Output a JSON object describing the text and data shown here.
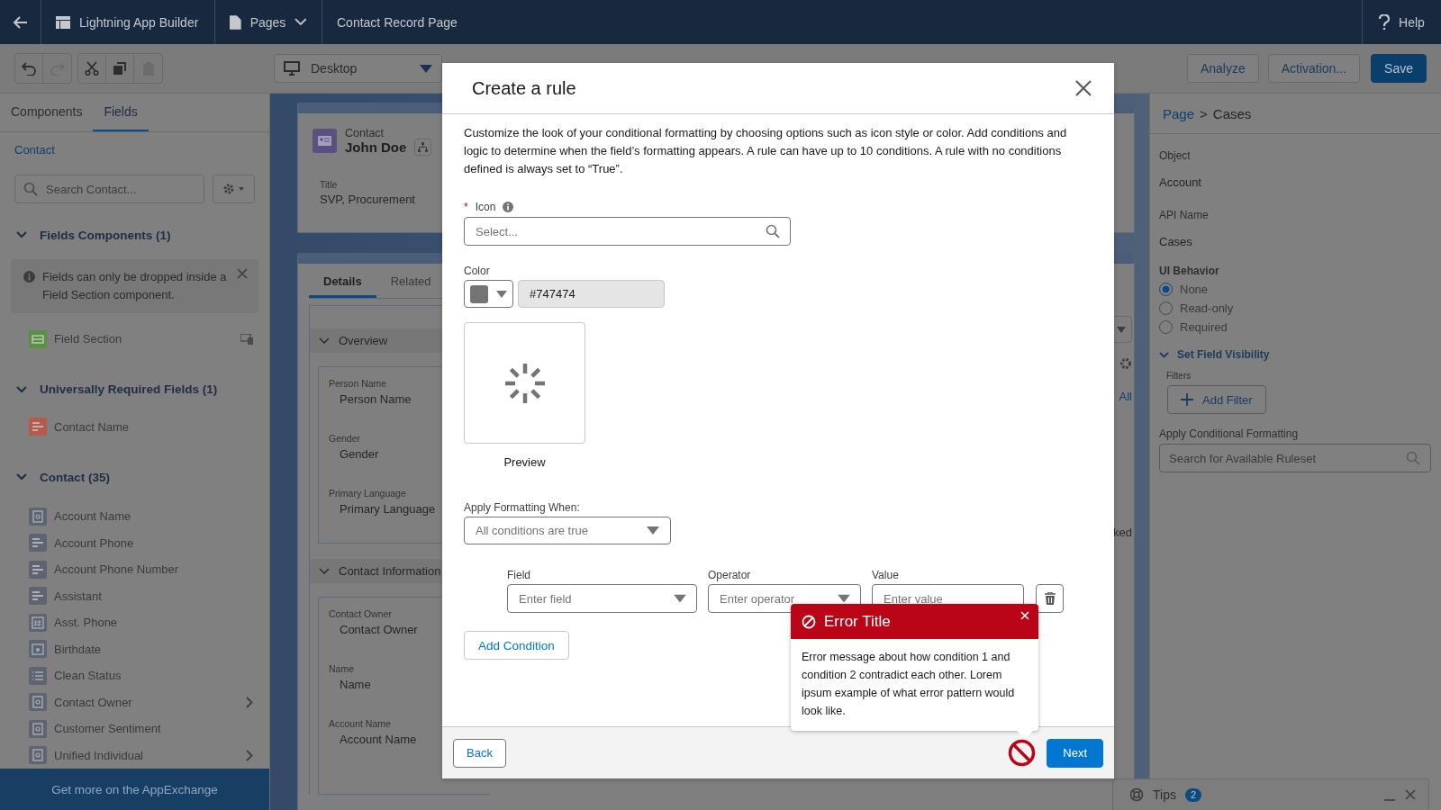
{
  "top_bar": {
    "app_name": "Lightning App Builder",
    "pages_menu": "Pages",
    "page_name": "Contact Record Page",
    "help": "Help"
  },
  "toolbar": {
    "tools": [
      {
        "kind": "undo",
        "disabled": false
      },
      {
        "kind": "redo",
        "disabled": true
      },
      {
        "kind": "cut",
        "disabled": false
      },
      {
        "kind": "copy",
        "disabled": false
      },
      {
        "kind": "paste",
        "disabled": true
      }
    ],
    "device": "Desktop",
    "buttons": [
      {
        "label": "Analyze",
        "kind": "outline"
      },
      {
        "label": "Activation...",
        "kind": "outline"
      },
      {
        "label": "Save",
        "kind": "brand"
      }
    ]
  },
  "left_panel": {
    "tabs": [
      {
        "label": "Components",
        "selected": false
      },
      {
        "label": "Fields",
        "selected": true
      }
    ],
    "object_link": "Contact",
    "search": {
      "placeholder": "Search Contact..."
    },
    "sections": [
      {
        "title": "Fields Components (1)",
        "expanded": true,
        "notice": "Fields can only be dropped inside a Field Section component.",
        "items": [
          {
            "label": "Field Section",
            "kind": "section",
            "color": "#5a8f45",
            "expandable": false,
            "device_icon": true
          }
        ]
      },
      {
        "title": "Universally Required Fields (1)",
        "expanded": true,
        "items": [
          {
            "label": "Contact Name",
            "kind": "text",
            "color": "#b65a4e",
            "expandable": false,
            "device_icon": false
          }
        ]
      },
      {
        "title": "Contact (35)",
        "expanded": true,
        "items": [
          {
            "label": "Account Name",
            "kind": "lookup",
            "color": "#5d6472",
            "expandable": false,
            "device_icon": false
          },
          {
            "label": "Account Phone",
            "kind": "text",
            "color": "#5d6472",
            "expandable": false,
            "device_icon": false
          },
          {
            "label": "Account Phone Number",
            "kind": "text",
            "color": "#5d6472",
            "expandable": false,
            "device_icon": false
          },
          {
            "label": "Assistant",
            "kind": "text",
            "color": "#5d6472",
            "expandable": false,
            "device_icon": false
          },
          {
            "label": "Asst. Phone",
            "kind": "number",
            "color": "#5d6472",
            "expandable": false,
            "device_icon": false
          },
          {
            "label": "Birthdate",
            "kind": "date",
            "color": "#5d6472",
            "expandable": false,
            "device_icon": false
          },
          {
            "label": "Clean Status",
            "kind": "picklist",
            "color": "#5d6472",
            "expandable": false,
            "device_icon": false
          },
          {
            "label": "Contact Owner",
            "kind": "lookup",
            "color": "#5d6472",
            "expandable": true,
            "device_icon": false
          },
          {
            "label": "Customer Sentiment",
            "kind": "lookup",
            "color": "#5d6472",
            "expandable": false,
            "device_icon": false
          },
          {
            "label": "Unified Individual",
            "kind": "lookup",
            "color": "#5d6472",
            "expandable": true,
            "device_icon": false
          }
        ]
      }
    ],
    "footer": "Get more on the AppExchange"
  },
  "canvas": {
    "header": {
      "object": "Contact",
      "name": "John Doe",
      "field_label": "Title",
      "field_value": "SVP, Procurement"
    },
    "tabs": [
      {
        "label": "Details",
        "selected": true
      },
      {
        "label": "Related",
        "selected": false
      }
    ],
    "sections": [
      {
        "title": "Overview",
        "fields": [
          {
            "label": "Person Name",
            "value": "Person Name"
          },
          {
            "label": "Gender",
            "value": "Gender"
          },
          {
            "label": "Primary Language",
            "value": "Primary Language"
          }
        ]
      },
      {
        "title": "Contact Information",
        "fields": [
          {
            "label": "Contact Owner",
            "value": "Contact Owner"
          },
          {
            "label": "Name",
            "value": "Name"
          },
          {
            "label": "Account Name",
            "value": "Account Name"
          }
        ]
      }
    ],
    "cut_link": "All",
    "cut_text": "ked"
  },
  "right_panel": {
    "breadcrumb": {
      "link": "Page",
      "separator": ">",
      "current": "Cases"
    },
    "properties": [
      {
        "label": "Object",
        "value": "Account"
      },
      {
        "label": "API Name",
        "value": "Cases"
      }
    ],
    "ui_behavior": {
      "label": "UI Behavior",
      "options": [
        {
          "label": "None",
          "selected": true
        },
        {
          "label": "Read-only",
          "selected": false
        },
        {
          "label": "Required",
          "selected": false
        }
      ]
    },
    "visibility": {
      "title": "Set Field Visibility",
      "expanded": true,
      "filters_label": "Filters",
      "add_filter": "Add Filter"
    },
    "formatting": {
      "label": "Apply Conditional Formatting",
      "placeholder": "Search for Available Ruleset"
    }
  },
  "tips": {
    "label": "Tips",
    "count": "2"
  },
  "modal": {
    "title": "Create a rule",
    "description": "Customize the look of your conditional formatting by choosing options such as icon style or color. Add conditions and logic to determine when the field’s formatting appears. A rule can have up to 10 conditions. A rule with no conditions defined is always set to “True”.",
    "icon_field": {
      "required_mark": "*",
      "label": "Icon",
      "required": true,
      "placeholder": "Select..."
    },
    "color_field": {
      "label": "Color",
      "value": "#747474"
    },
    "preview_label": "Preview",
    "apply_when": {
      "label": "Apply Formatting When:",
      "value": "All conditions are true"
    },
    "condition": {
      "field": {
        "label": "Field",
        "placeholder": "Enter field"
      },
      "operator": {
        "label": "Operator",
        "placeholder": "Enter operator"
      },
      "value": {
        "label": "Value",
        "placeholder": "Enter value"
      }
    },
    "add_condition": "Add Condition",
    "back": "Back",
    "next": "Next",
    "has_error": true,
    "error": {
      "title": "Error Title",
      "message": "Error message about how condition 1 and condition 2 contradict each other. Lorem ipsum example of what error pattern would look like."
    }
  }
}
